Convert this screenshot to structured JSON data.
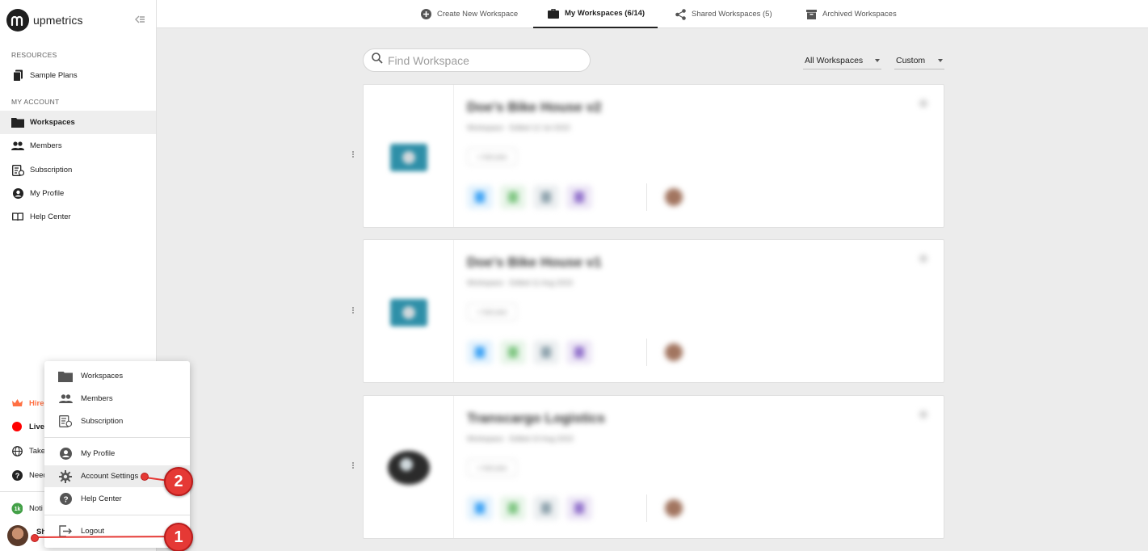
{
  "brand": {
    "name": "upmetrics"
  },
  "sidebar": {
    "sections": [
      {
        "label": "RESOURCES"
      },
      {
        "label": "MY ACCOUNT"
      }
    ],
    "items": [
      {
        "label": "Sample Plans",
        "icon": "document-icon"
      },
      {
        "label": "Workspaces",
        "icon": "folder-icon",
        "active": true
      },
      {
        "label": "Members",
        "icon": "people-icon"
      },
      {
        "label": "Subscription",
        "icon": "subscription-icon"
      },
      {
        "label": "My Profile",
        "icon": "account-circle-icon"
      },
      {
        "label": "Help Center",
        "icon": "book-icon"
      }
    ],
    "bottom": [
      {
        "label": "Hire",
        "icon": "crown-icon",
        "color": "#ff7043"
      },
      {
        "label": "Live",
        "icon": "live-dot-icon",
        "color": "#ff0000"
      },
      {
        "label": "Take",
        "icon": "globe-icon"
      },
      {
        "label": "Need",
        "icon": "help-icon"
      },
      {
        "label": "Noti",
        "icon": "notification-badge",
        "badge": "1k"
      },
      {
        "label": "Sh",
        "icon": "avatar"
      }
    ]
  },
  "tabs": [
    {
      "label": "Create New Workspace",
      "icon": "add-circle-icon"
    },
    {
      "label": "My Workspaces (6/14)",
      "icon": "briefcase-icon",
      "active": true
    },
    {
      "label": "Shared Workspaces (5)",
      "icon": "share-icon"
    },
    {
      "label": "Archived Workspaces",
      "icon": "archive-icon"
    }
  ],
  "search": {
    "placeholder": "Find Workspace"
  },
  "filters": {
    "scope": "All Workspaces",
    "sort": "Custom"
  },
  "cards": [
    {
      "title": "Doe's Bike House v2",
      "subtitle": "Workspace · Edited 12 Jul 2023",
      "pill": "+ Add plan"
    },
    {
      "title": "Doe's Bike House v1",
      "subtitle": "Workspace · Edited 11 Aug 2023",
      "pill": "+ Add plan"
    },
    {
      "title": "Transcargo Logistics",
      "subtitle": "Workspace · Edited 10 Aug 2023",
      "pill": "+ Add plan"
    }
  ],
  "popup_menu": {
    "items": [
      {
        "label": "Workspaces",
        "icon": "folder-icon"
      },
      {
        "label": "Members",
        "icon": "people-icon"
      },
      {
        "label": "Subscription",
        "icon": "subscription-icon"
      },
      {
        "label": "My Profile",
        "icon": "account-circle-icon"
      },
      {
        "label": "Account Settings",
        "icon": "gear-icon",
        "highlighted": true
      },
      {
        "label": "Help Center",
        "icon": "help-icon"
      },
      {
        "label": "Logout",
        "icon": "logout-icon"
      }
    ]
  },
  "annotations": [
    {
      "number": "1"
    },
    {
      "number": "2"
    }
  ],
  "colors": {
    "accent": "#e53935",
    "active_bg": "#eeeeee",
    "page_bg": "#ececec"
  }
}
